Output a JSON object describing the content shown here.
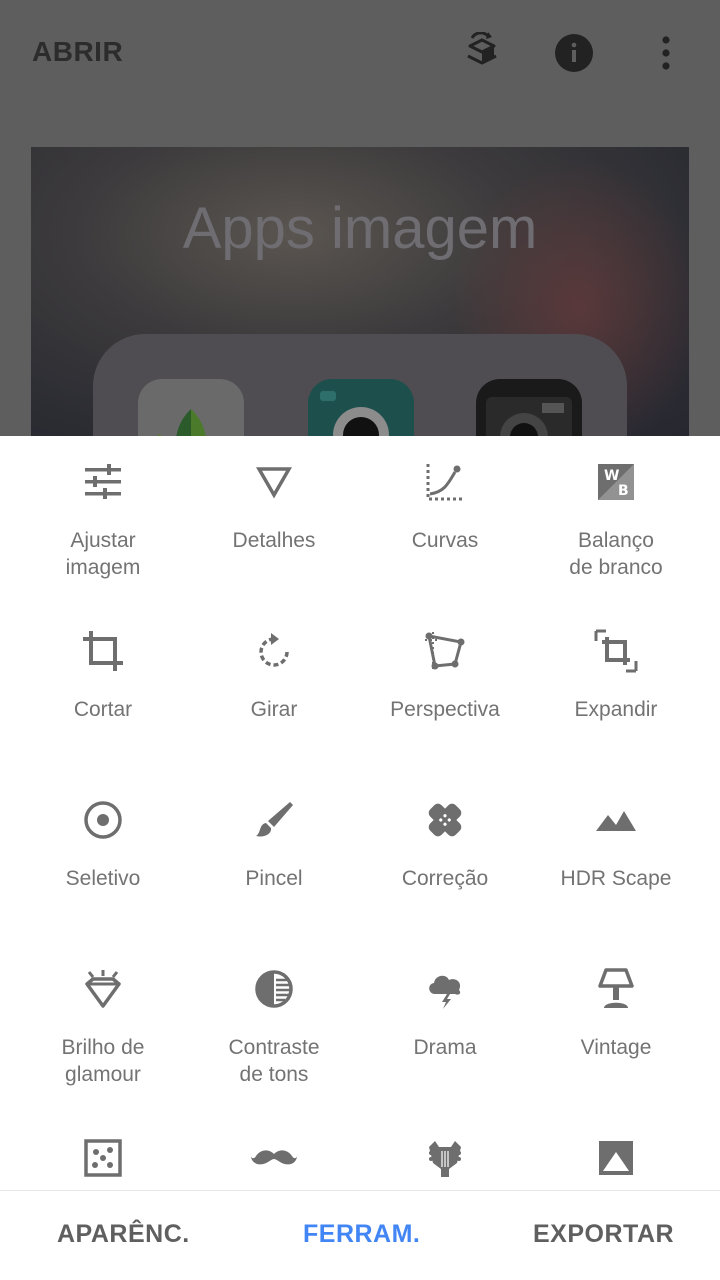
{
  "app_bar": {
    "open_label": "ABRIR",
    "icons": [
      "stack-revert-icon",
      "info-icon",
      "more-vert-icon"
    ]
  },
  "photo": {
    "title": "Apps imagem"
  },
  "tools": [
    {
      "label": "Ajustar\nimagem",
      "icon": "tune-icon"
    },
    {
      "label": "Detalhes",
      "icon": "triangle-down-icon"
    },
    {
      "label": "Curvas",
      "icon": "curves-icon"
    },
    {
      "label": "Balanço\nde branco",
      "icon": "white-balance-icon"
    },
    {
      "label": "Cortar",
      "icon": "crop-icon"
    },
    {
      "label": "Girar",
      "icon": "rotate-icon"
    },
    {
      "label": "Perspectiva",
      "icon": "perspective-icon"
    },
    {
      "label": "Expandir",
      "icon": "expand-icon"
    },
    {
      "label": "Seletivo",
      "icon": "selective-icon"
    },
    {
      "label": "Pincel",
      "icon": "brush-icon"
    },
    {
      "label": "Correção",
      "icon": "healing-icon"
    },
    {
      "label": "HDR Scape",
      "icon": "landscape-icon"
    },
    {
      "label": "Brilho de\nglamour",
      "icon": "glamour-icon"
    },
    {
      "label": "Contraste\nde tons",
      "icon": "tonal-contrast-icon"
    },
    {
      "label": "Drama",
      "icon": "drama-cloud-icon"
    },
    {
      "label": "Vintage",
      "icon": "vintage-lamp-icon"
    },
    {
      "label": "",
      "icon": "grainy-film-icon"
    },
    {
      "label": "",
      "icon": "mustache-icon"
    },
    {
      "label": "",
      "icon": "grunge-guitar-icon"
    },
    {
      "label": "",
      "icon": "black-white-icon"
    }
  ],
  "bottom_nav": {
    "tabs": [
      "APARÊNC.",
      "FERRAM.",
      "EXPORTAR"
    ],
    "active": "FERRAM."
  },
  "colors": {
    "accent": "#4285f4",
    "icon_gray": "#6e6e6e",
    "label_gray": "#737373",
    "scrim": "#5e5e5e"
  }
}
